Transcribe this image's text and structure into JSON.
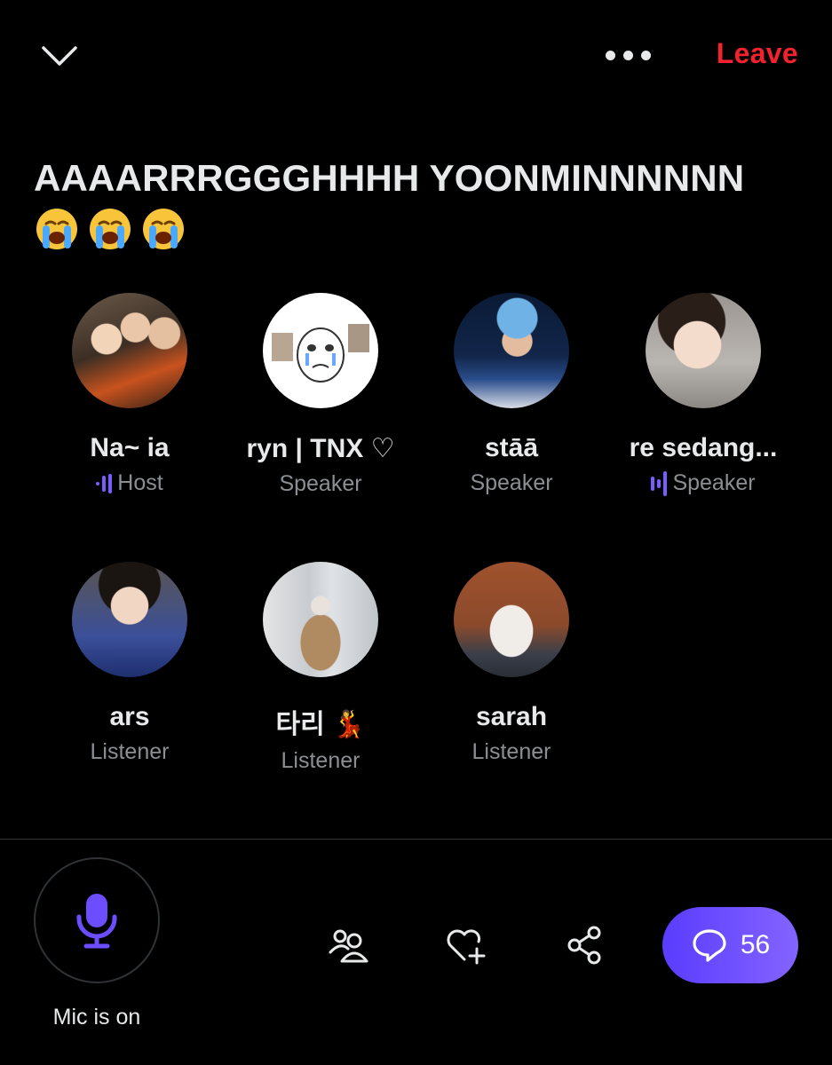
{
  "header": {
    "collapse_icon": "chevron-down-icon",
    "more_icon": "more-dots-icon",
    "leave_label": "Leave"
  },
  "space": {
    "title": "AAAARRRGGGHHHH YOONMINNNNNN",
    "title_emojis": [
      "😭",
      "😭",
      "😭"
    ]
  },
  "participants": [
    {
      "name": "Na~ ia",
      "role": "Host",
      "speaking": true
    },
    {
      "name": "ryn | TNX ♡",
      "role": "Speaker",
      "speaking": false
    },
    {
      "name": "stāā",
      "role": "Speaker",
      "speaking": false
    },
    {
      "name": "re sedang...",
      "role": "Speaker",
      "speaking": true
    },
    {
      "name": "ars",
      "role": "Listener",
      "speaking": false
    },
    {
      "name": "타리 💃",
      "role": "Listener",
      "speaking": false
    },
    {
      "name": "sarah",
      "role": "Listener",
      "speaking": false
    }
  ],
  "footer": {
    "mic_label": "Mic is on",
    "mic_icon": "microphone-icon",
    "people_icon": "people-icon",
    "react_icon": "heart-plus-icon",
    "share_icon": "share-icon",
    "comment_icon": "comment-icon",
    "comment_count": "56"
  },
  "colors": {
    "background": "#000000",
    "accent": "#7c5cff",
    "leave": "#f4212e",
    "muted_text": "#8b8f94"
  }
}
